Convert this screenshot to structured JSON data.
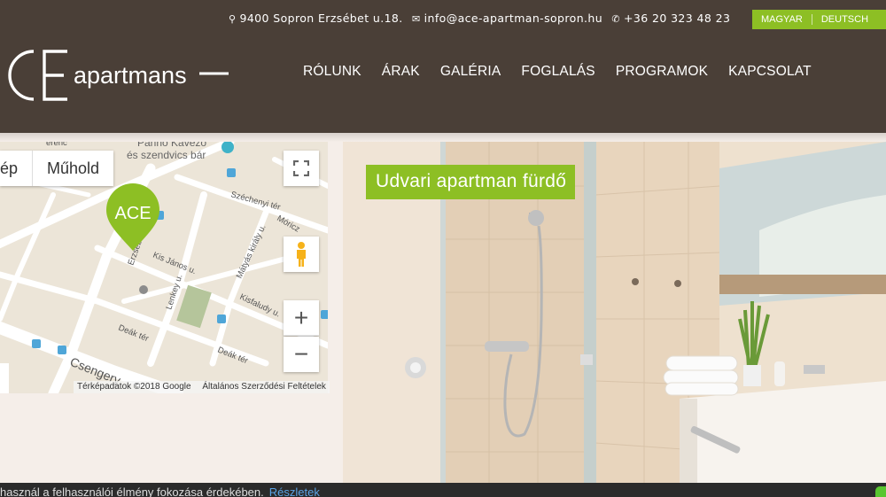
{
  "header": {
    "address": "9400 Sopron Erzsébet u.18.",
    "email": "info@ace-apartman-sopron.hu",
    "phone": "+36 20 323 48 23",
    "languages": [
      "MAGYAR",
      "DEUTSCH"
    ],
    "logo_text": "apartmans",
    "logo_mark": "ACE"
  },
  "nav": {
    "items": [
      "RÓLUNK",
      "ÁRAK",
      "GALÉRIA",
      "FOGLALÁS",
      "PROGRAMOK",
      "KAPCSOLAT"
    ]
  },
  "map": {
    "type_buttons": [
      "ép",
      "Műhold"
    ],
    "marker_label": "ACE",
    "attribution": "Térképadatok ©2018 Google",
    "terms": "Általános Szerződési Feltételek",
    "zoom_in": "+",
    "zoom_out": "−",
    "fullscreen_icon": "fullscreen-icon",
    "pegman_icon": "pegman-icon",
    "labels": {
      "poi": "Panno Kávézó",
      "poi2": "és szendvics bár",
      "szechenyi": "Széchenyi tér",
      "moricz": "Móricz",
      "erzsebet": "Erzsébet u.",
      "kis_janos": "Kis János u.",
      "matyas": "Mátyás király u.",
      "lenkey": "Lenkey u.",
      "kisfaludy": "Kisfaludy u.",
      "deak1": "Deák tér",
      "deak2": "Deák tér",
      "csengery": "Csengery",
      "ferenc": "erenc"
    }
  },
  "photo": {
    "caption": "Udvari apartman fürdő"
  },
  "cookie": {
    "text": "használ a felhasználói élmény fokozása érdekében.",
    "link": "Részletek"
  },
  "colors": {
    "header_bg": "#4a3f37",
    "accent": "#8dbf24",
    "page_bg": "#f5eee9"
  }
}
